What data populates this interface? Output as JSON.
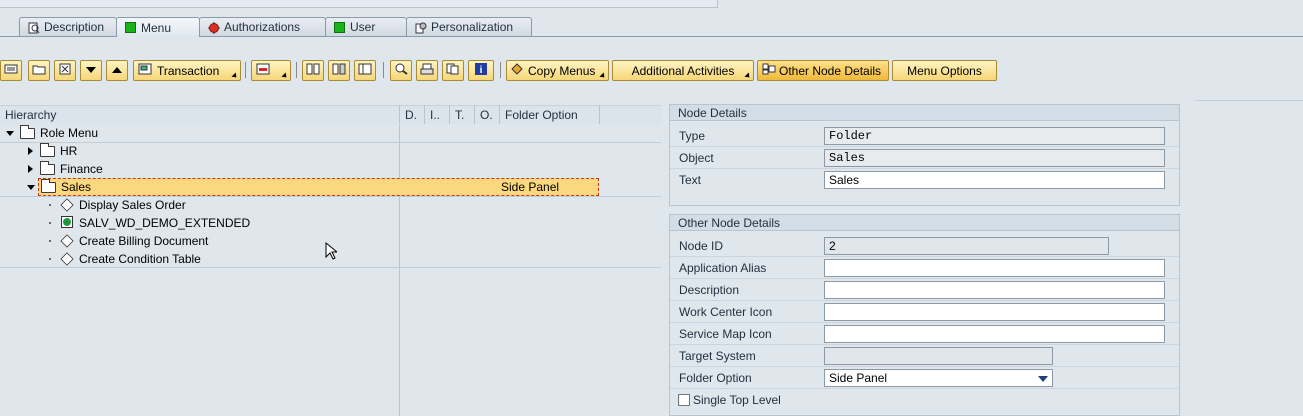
{
  "tabs": [
    {
      "label": "Description",
      "icon": "magnifier-doc-icon"
    },
    {
      "label": "Menu",
      "icon": "green-square-icon"
    },
    {
      "label": "Authorizations",
      "icon": "red-status-icon"
    },
    {
      "label": "User",
      "icon": "green-square-icon"
    },
    {
      "label": "Personalization",
      "icon": "settings-doc-icon"
    }
  ],
  "toolbar": {
    "transaction": "Transaction",
    "copy_menus": "Copy Menus",
    "additional_activities": "Additional Activities",
    "other_node_details": "Other Node Details",
    "menu_options": "Menu Options"
  },
  "tree": {
    "columns": [
      "Hierarchy",
      "D.",
      "I..",
      "T.",
      "O.",
      "Folder Option"
    ],
    "root": "Role Menu",
    "nodes": [
      {
        "label": "HR",
        "type": "folder",
        "expanded": false
      },
      {
        "label": "Finance",
        "type": "folder",
        "expanded": false
      },
      {
        "label": "Sales",
        "type": "folder",
        "expanded": true,
        "selected": true,
        "folder_option": "Side Panel"
      },
      {
        "label": "Display Sales Order",
        "type": "transaction"
      },
      {
        "label": "SALV_WD_DEMO_EXTENDED",
        "type": "webdynpro"
      },
      {
        "label": "Create Billing Document",
        "type": "transaction"
      },
      {
        "label": "Create Condition Table",
        "type": "transaction"
      }
    ]
  },
  "node_details": {
    "title": "Node Details",
    "type_label": "Type",
    "type_value": "Folder",
    "object_label": "Object",
    "object_value": "Sales",
    "text_label": "Text",
    "text_value": "Sales"
  },
  "other_details": {
    "title": "Other Node Details",
    "node_id_label": "Node ID",
    "node_id_value": "2",
    "app_alias_label": "Application Alias",
    "app_alias_value": "",
    "description_label": "Description",
    "description_value": "",
    "work_center_icon_label": "Work Center Icon",
    "work_center_icon_value": "",
    "service_map_icon_label": "Service Map Icon",
    "service_map_icon_value": "",
    "target_system_label": "Target System",
    "target_system_value": "",
    "folder_option_label": "Folder Option",
    "folder_option_value": "Side Panel",
    "single_top_level_label": "Single Top Level",
    "single_top_level_checked": false
  },
  "colors": {
    "accent": "#f6d677",
    "selected_row": "#fbd87e",
    "background": "#dfe6ec"
  }
}
